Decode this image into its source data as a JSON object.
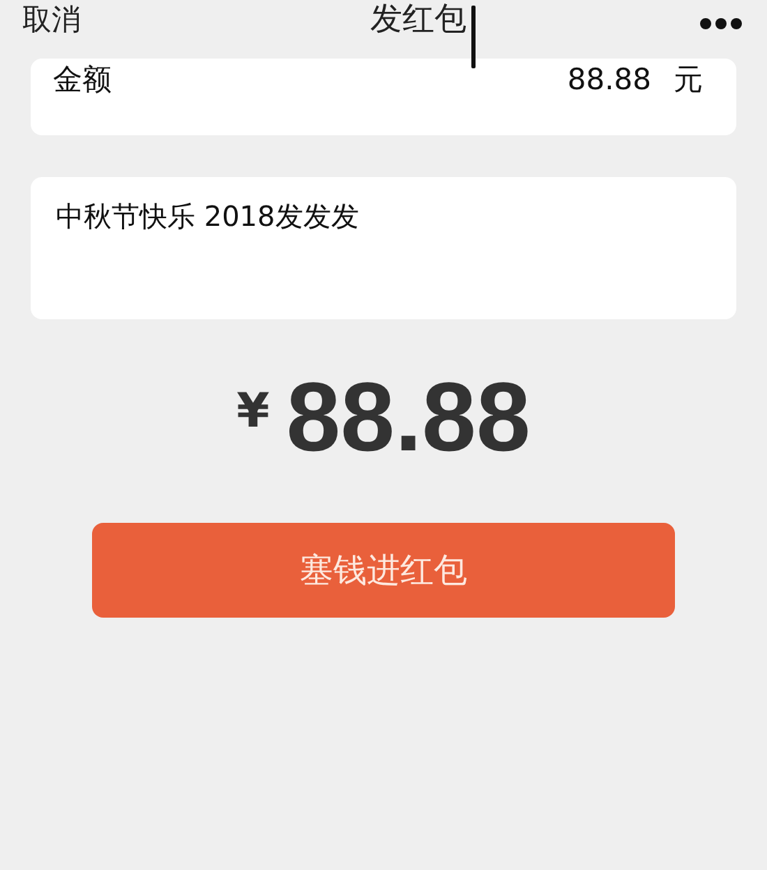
{
  "nav_bar": {
    "cancel": "取消",
    "title": "发红包"
  },
  "amount_field": {
    "label": "金额",
    "value": "88.88",
    "unit": "元"
  },
  "message_field": {
    "value": "中秋节快乐 2018发发发"
  },
  "total": {
    "currency": "¥",
    "amount": "88.88"
  },
  "submit_button": {
    "label": "塞钱进红包"
  }
}
